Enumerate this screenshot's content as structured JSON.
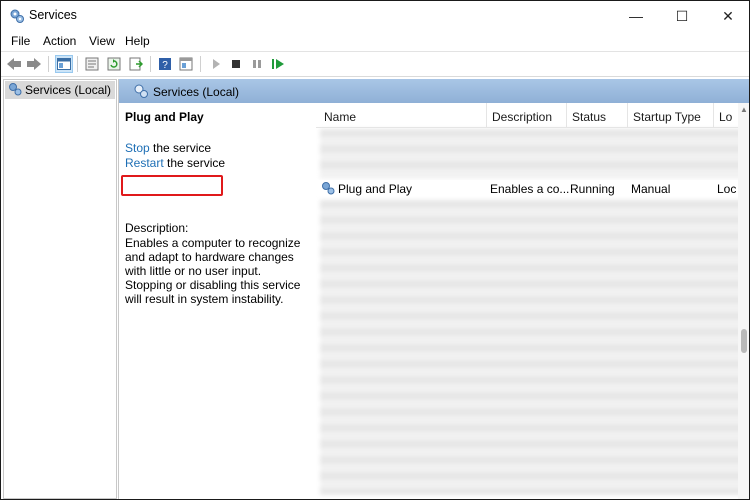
{
  "window": {
    "title": "Services",
    "icon": "gear-icon",
    "controls": {
      "minimize": "—",
      "maximize": "☐",
      "close": "✕"
    }
  },
  "menu": [
    "File",
    "Action",
    "View",
    "Help"
  ],
  "toolbar": {
    "icons": [
      "back-arrow-icon",
      "forward-arrow-icon",
      "console-tree-icon",
      "properties-icon",
      "refresh-icon",
      "export-list-icon",
      "help-icon",
      "view-icon",
      "start-icon",
      "stop-icon",
      "pause-icon",
      "restart-icon"
    ]
  },
  "tree": {
    "node_label": "Services (Local)"
  },
  "header": {
    "title": "Services (Local)"
  },
  "details": {
    "service_name": "Plug and Play",
    "stop_link": "Stop",
    "stop_rest": " the service",
    "restart_link": "Restart",
    "restart_rest": " the service",
    "desc_label": "Description:",
    "desc_text": "Enables a computer to recognize and adapt to hardware changes with little or no user input. Stopping or disabling this service will result in system instability."
  },
  "columns": [
    "Name",
    "Description",
    "Status",
    "Startup Type",
    "Log"
  ],
  "columns_visible": [
    "Name",
    "Description",
    "Status",
    "Startup Type",
    "Lo("
  ],
  "selected_row": {
    "name": "Plug and Play",
    "description": "Enables a co...",
    "status": "Running",
    "startup_type": "Manual",
    "log_on": "Loc"
  },
  "colors": {
    "highlight_box": "#e0191b",
    "header_bg": "#8fb0d6",
    "link": "#1e6fb5",
    "visited_link": "#7a3a9a"
  }
}
